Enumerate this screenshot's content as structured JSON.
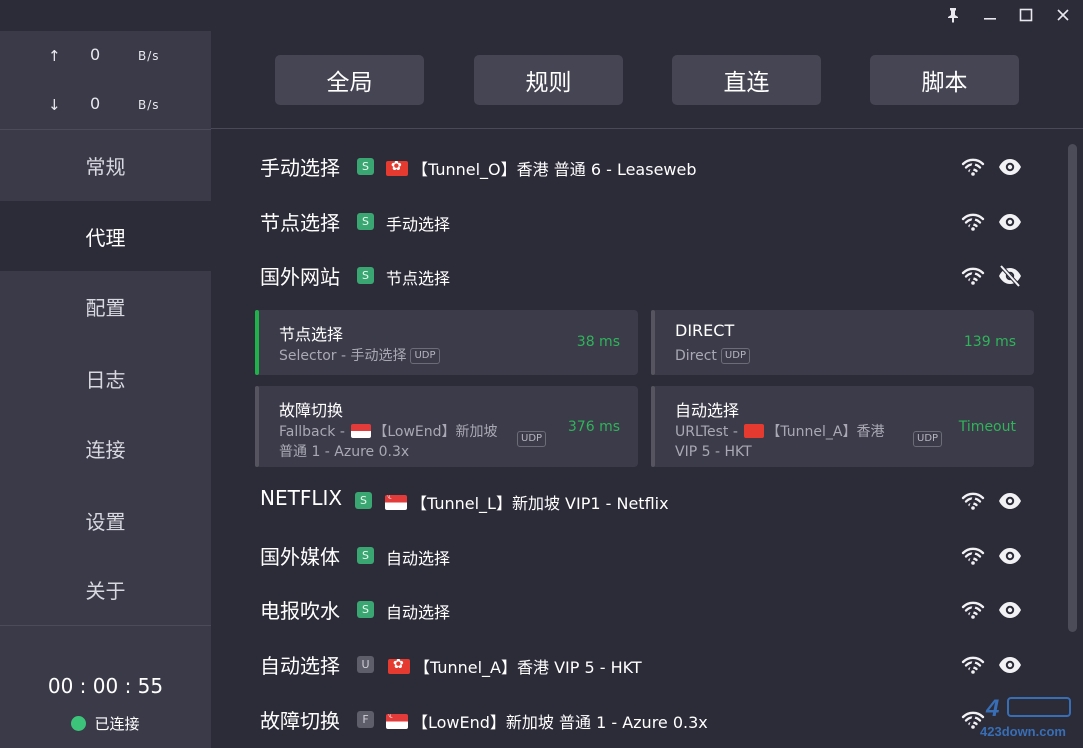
{
  "window": {
    "pin_icon": "pin-icon",
    "minimize_icon": "minimize-icon",
    "maximize_icon": "maximize-icon",
    "close_icon": "close-icon"
  },
  "traffic": {
    "up_arrow": "↑",
    "up_value": "0",
    "up_unit": "B/s",
    "down_arrow": "↓",
    "down_value": "0",
    "down_unit": "B/s"
  },
  "nav": {
    "items": [
      {
        "label": "常规"
      },
      {
        "label": "代理"
      },
      {
        "label": "配置"
      },
      {
        "label": "日志"
      },
      {
        "label": "连接"
      },
      {
        "label": "设置"
      },
      {
        "label": "关于"
      }
    ],
    "active_index": 1
  },
  "status": {
    "timer": "00 : 00 : 55",
    "connection": "已连接",
    "connection_color": "#3bc47a"
  },
  "modes": [
    "全局",
    "规则",
    "直连",
    "脚本"
  ],
  "groups": [
    {
      "name": "手动选择",
      "badge": "S",
      "flag": "hk",
      "current": "【Tunnel_O】香港 普通 6 - Leaseweb",
      "visible": true
    },
    {
      "name": "节点选择",
      "badge": "S",
      "flag": "",
      "current": "手动选择",
      "visible": true
    },
    {
      "name": "国外网站",
      "badge": "S",
      "flag": "",
      "current": "节点选择",
      "visible": false
    },
    {
      "name": "NETFLIX",
      "badge": "S",
      "flag": "sg",
      "current": "【Tunnel_L】新加坡 VIP1 - Netflix",
      "visible": true
    },
    {
      "name": "国外媒体",
      "badge": "S",
      "flag": "",
      "current": "自动选择",
      "visible": true
    },
    {
      "name": "电报吹水",
      "badge": "S",
      "flag": "",
      "current": "自动选择",
      "visible": true
    },
    {
      "name": "自动选择",
      "badge": "U",
      "flag": "hk",
      "current": "【Tunnel_A】香港 VIP 5 - HKT",
      "visible": true
    },
    {
      "name": "故障切换",
      "badge": "F",
      "flag": "sg",
      "current": "【LowEnd】新加坡 普通 1 - Azure 0.3x",
      "visible": true
    }
  ],
  "cards": [
    {
      "title": "节点选择",
      "type": "Selector",
      "detail": "手动选择",
      "udp": "UDP",
      "latency": "38 ms",
      "selected": true
    },
    {
      "title": "DIRECT",
      "type": "Direct",
      "detail": "",
      "udp": "UDP",
      "latency": "139 ms",
      "selected": false
    },
    {
      "title": "故障切换",
      "type": "Fallback",
      "detail_line1": "【LowEnd】新加坡",
      "detail_line2": "普通 1 - Azure 0.3x",
      "udp": "UDP",
      "latency": "376 ms",
      "flag": "sg",
      "selected": false
    },
    {
      "title": "自动选择",
      "type": "URLTest",
      "detail_line1": "【Tunnel_A】香港",
      "detail_line2": "VIP 5 - HKT",
      "udp": "UDP",
      "latency": "Timeout",
      "flag": "hk",
      "selected": false
    }
  ],
  "separator": " - ",
  "watermark": "423down.com",
  "colors": {
    "accent_green": "#1fb24a",
    "latency_green": "#2fb45a",
    "badge_green": "#3aa772"
  }
}
